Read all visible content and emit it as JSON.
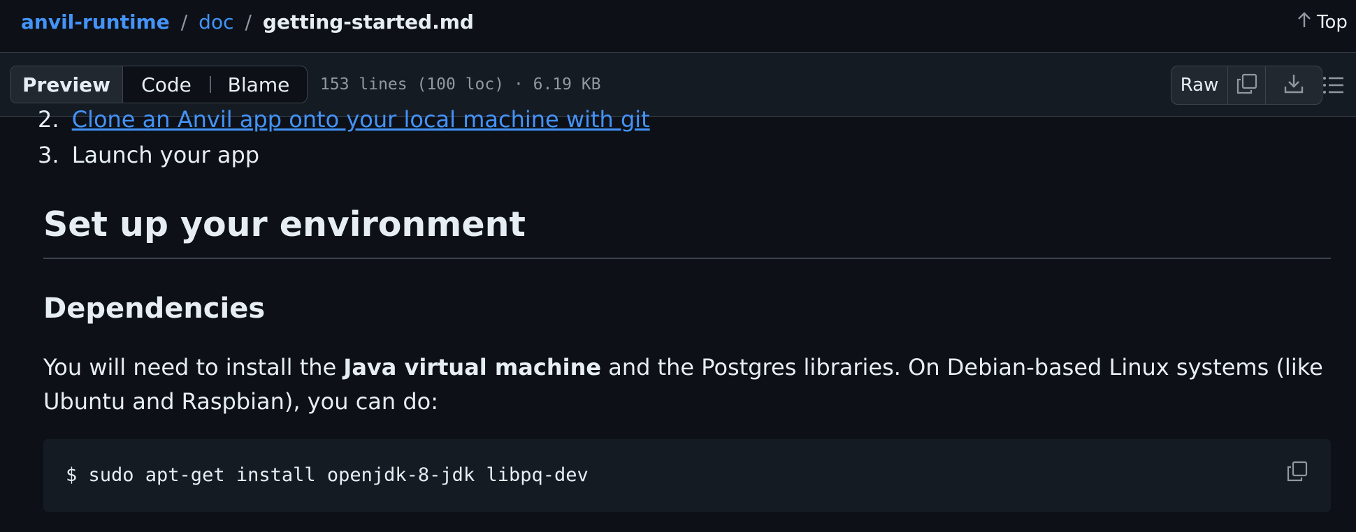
{
  "breadcrumb": {
    "repo": "anvil-runtime",
    "separator": "/",
    "folder": "doc",
    "file": "getting-started.md"
  },
  "top_link": {
    "label": "Top"
  },
  "toolbar": {
    "tabs": [
      {
        "label": "Preview",
        "active": true
      },
      {
        "label": "Code",
        "active": false
      },
      {
        "label": "Blame",
        "active": false
      }
    ],
    "file_info": "153 lines (100 loc) · 6.19 KB",
    "raw_label": "Raw"
  },
  "content": {
    "list_items": [
      {
        "number": "2.",
        "text": "Clone an Anvil app onto your local machine with git",
        "link": true
      },
      {
        "number": "3.",
        "text": "Launch your app",
        "link": false
      }
    ],
    "heading_environment": "Set up your environment",
    "heading_dependencies": "Dependencies",
    "paragraph": {
      "before": "You will need to install the ",
      "bold": "Java virtual machine",
      "after": " and the Postgres libraries. On Debian-based Linux systems (like Ubuntu and Raspbian), you can do:"
    },
    "code": "$ sudo apt-get install openjdk-8-jdk libpq-dev"
  },
  "colors": {
    "background": "#0d1117",
    "toolbar": "#151b23",
    "link": "#4493f8",
    "text": "#e6edf3",
    "muted": "#9198a1",
    "border": "#3d444d"
  },
  "icons": [
    "arrow-up-icon",
    "copy-icon",
    "download-icon",
    "list-unordered-icon",
    "copy-code-icon"
  ]
}
